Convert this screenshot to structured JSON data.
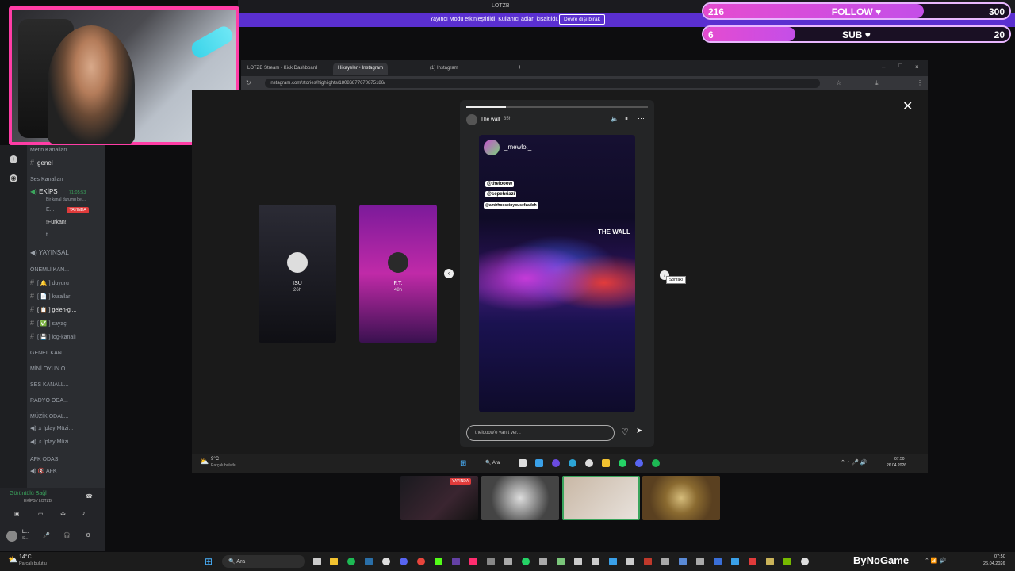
{
  "stream_title": "LOTZB",
  "banner": {
    "message": "Yayıncı Modu etkinleştirildi. Kullanıcı adları kısaltıldı.",
    "button": "Devre dışı bırak"
  },
  "overlay": {
    "follow": {
      "current": "216",
      "label": "FOLLOW ♥",
      "goal": "300",
      "progress": 0.72
    },
    "sub": {
      "current": "6",
      "label": "SUB ♥",
      "goal": "20",
      "progress": 0.3
    }
  },
  "discord": {
    "sections": {
      "text": "Metin Kanalları",
      "voice": "Ses Kanalları"
    },
    "channel_genel": "genel",
    "voice_channel": {
      "name": "EKİPS",
      "time": "71:05:53",
      "status": "Bir kanal durumu bel..."
    },
    "members": [
      {
        "name": "E...",
        "badge": "YAYINDA"
      },
      {
        "name": "!Furkan!"
      },
      {
        "name": "t..."
      }
    ],
    "yayinsal": "YAYINSAL",
    "categories": [
      {
        "label": "ÖNEMLİ KAN..."
      },
      {
        "label": "duyuru",
        "prefix": "[ 🔔 ]"
      },
      {
        "label": "kurallar",
        "prefix": "[ 📄 ]"
      },
      {
        "label": "gelen-gi...",
        "prefix": "[ 📋 ]"
      },
      {
        "label": "sayaç",
        "prefix": "[ ✅ ]"
      },
      {
        "label": "log-kanalı",
        "prefix": "[ 💾 ]"
      }
    ],
    "groups": [
      "GENEL KAN...",
      "MİNİ OYUN O...",
      "SES KANALL...",
      "RADYO ODA...",
      "MÜZİK ODAL..."
    ],
    "music": [
      "!play Müzi...",
      "!play Müzi..."
    ],
    "afk_group": "AFK ODASI",
    "afk": "AFK",
    "voice_connected": {
      "title": "Görüntülü Bağl",
      "subtitle": "EKİPS / LOTZB"
    },
    "user": {
      "name": "L...",
      "status": "S..."
    }
  },
  "browser": {
    "tabs": [
      "LOTZB Stream - Kick Dashboard",
      "Hikayeler • Instagram",
      "(1) Instagram"
    ],
    "url": "instagram.com/stories/highlights/18086877670875186/"
  },
  "story": {
    "account": "The wall",
    "age": "35h",
    "post_user": "_mewlo._",
    "tags": [
      "@thelooow",
      "@sepehriazi",
      "@amirhosseinyousefzadeh"
    ],
    "sign": "THE WALL",
    "reply_placeholder": "thelooow'e yanıt ver...",
    "prev": [
      {
        "label": "ISU",
        "age": "26h"
      },
      {
        "label": "F.T.",
        "age": "48h"
      }
    ],
    "next_tooltip": "Sonraki"
  },
  "inner_taskbar": {
    "weather": "9°C",
    "weather_sub": "Parçalı bulutlu",
    "search": "Ara",
    "time": "07:50",
    "date": "26.04.2026"
  },
  "thumb_badge": "YAYINDA",
  "outer_taskbar": {
    "weather": "14°C",
    "weather_sub": "Parçalı bulutlu",
    "search": "Ara",
    "brand": "ByNoGame",
    "time": "07:50",
    "date": "26.04.2026"
  },
  "colors": {
    "accent_pink": "#ff3da6",
    "banner_purple": "#5a2fd0",
    "discord_bg": "#2b2d31"
  }
}
